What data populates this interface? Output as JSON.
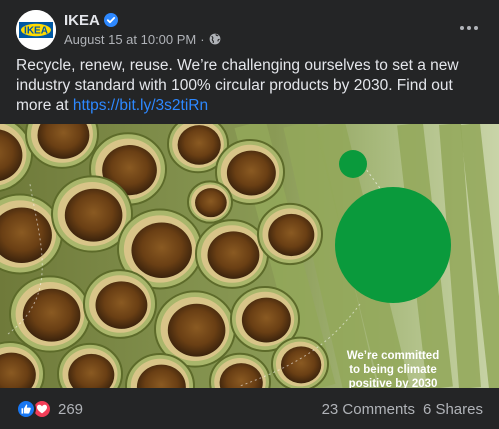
{
  "page": {
    "name": "IKEA",
    "logo_text": "IKEA",
    "date": "August 15 at 10:00 PM",
    "separator": "·",
    "audience_icon": "globe-icon",
    "verified_icon": "verified-badge-icon"
  },
  "post": {
    "text": "Recycle, renew, reuse. We’re challenging ourselves to set a new industry standard with 100% circular products by 2030. Find out more at ",
    "link": "https://bit.ly/3s2tiRn"
  },
  "image": {
    "caption": "We’re committed to being climate positive by 2030",
    "accent_color": "#0a9a3c"
  },
  "engagement": {
    "reaction_icons": [
      "like-icon",
      "love-icon"
    ],
    "reaction_count": "269",
    "comments": "23 Comments",
    "shares": "6 Shares"
  },
  "colors": {
    "background": "#242526",
    "text": "#e4e6eb",
    "secondary_text": "#b0b3b8",
    "link": "#2d88ff",
    "verified": "#2d88ff",
    "like": "#1877f2",
    "love": "#f33e58",
    "ikea_blue": "#0058a3",
    "ikea_yellow": "#ffdb00"
  }
}
